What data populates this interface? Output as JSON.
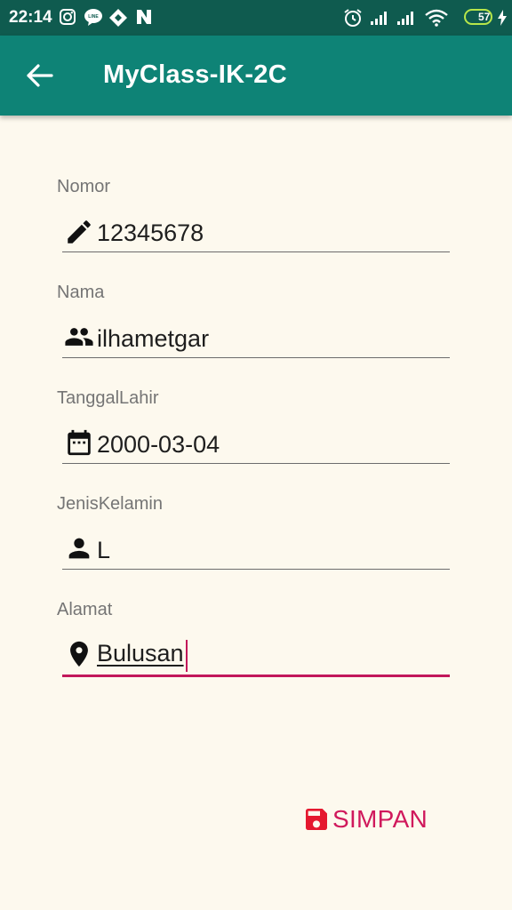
{
  "status_bar": {
    "time": "22:14",
    "battery_level": "57",
    "left_icons": [
      "instagram-icon",
      "line-icon",
      "app-icon",
      "n-icon"
    ],
    "right_icons": [
      "alarm-icon",
      "signal-icon",
      "signal-icon",
      "wifi-icon",
      "battery-icon",
      "charging-icon"
    ]
  },
  "app_bar": {
    "title": "MyClass-IK-2C",
    "back_icon": "arrow-left-icon",
    "color": "#0e8376"
  },
  "form": {
    "nomor": {
      "label": "Nomor",
      "value": "12345678",
      "icon": "pencil-icon"
    },
    "nama": {
      "label": "Nama",
      "value": "ilhametgar",
      "icon": "people-icon"
    },
    "tanggal_lahir": {
      "label": "TanggalLahir",
      "value": "2000-03-04",
      "icon": "calendar-icon"
    },
    "jenis_kelamin": {
      "label": "JenisKelamin",
      "value": "L",
      "icon": "person-icon"
    },
    "alamat": {
      "label": "Alamat",
      "value": "Bulusan",
      "icon": "location-pin-icon",
      "focused": true
    }
  },
  "save_button": {
    "label": "SIMPAN",
    "icon": "floppy-disk-icon",
    "color": "#d0195c"
  },
  "accent_color": "#c2185b"
}
